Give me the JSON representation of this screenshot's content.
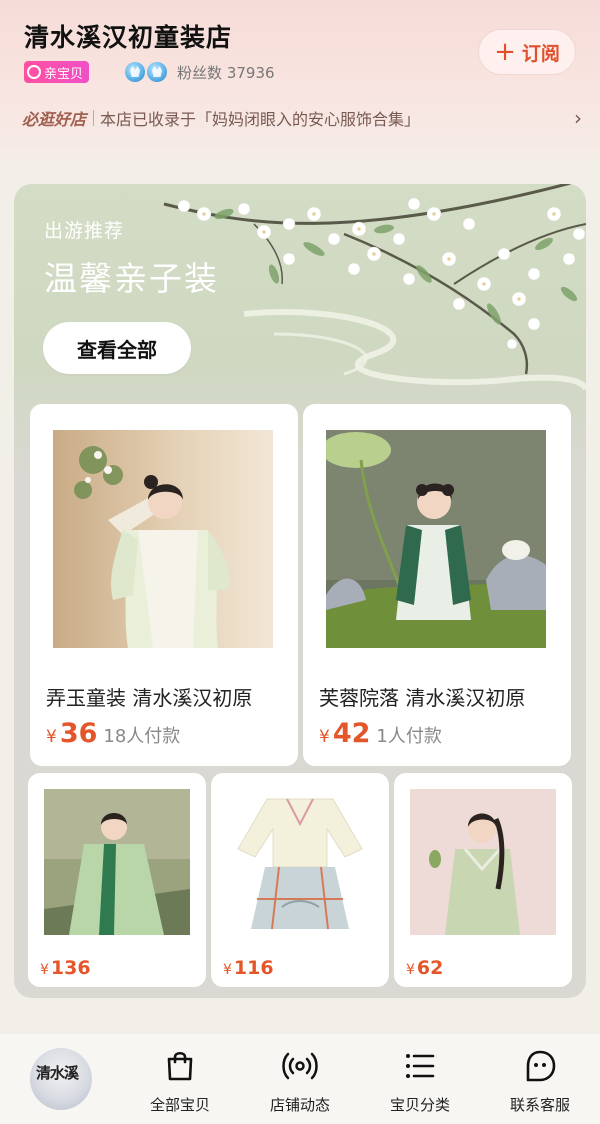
{
  "store": {
    "name": "清水溪汉初童装店",
    "badge": "亲宝贝",
    "fans_label": "粉丝数",
    "fans_count": "37936",
    "follow_label": "订阅",
    "promo_tag": "必逛好店",
    "promo_text": "本店已收录于「妈妈闭眼入的安心服饰合集」"
  },
  "banner": {
    "subtitle": "出游推荐",
    "title": "温馨亲子装",
    "view_all_label": "查看全部"
  },
  "featured_products": [
    {
      "title": "弄玉童装 清水溪汉初原",
      "currency": "¥",
      "price": "36",
      "sold": "18人付款"
    },
    {
      "title": "芙蓉院落 清水溪汉初原",
      "currency": "¥",
      "price": "42",
      "sold": "1人付款"
    }
  ],
  "small_products": [
    {
      "currency": "¥",
      "price": "136"
    },
    {
      "currency": "¥",
      "price": "116"
    },
    {
      "currency": "¥",
      "price": "62"
    }
  ],
  "bottom_nav": {
    "logo_text": "清水溪",
    "items": [
      {
        "label": "全部宝贝",
        "icon": "shopping-bag-icon"
      },
      {
        "label": "店铺动态",
        "icon": "broadcast-icon"
      },
      {
        "label": "宝贝分类",
        "icon": "list-icon"
      },
      {
        "label": "联系客服",
        "icon": "chat-face-icon"
      }
    ]
  },
  "colors": {
    "accent": "#e4562a",
    "header_bg": "#f6dcd8",
    "banner_bg": "#d3dcc5"
  }
}
